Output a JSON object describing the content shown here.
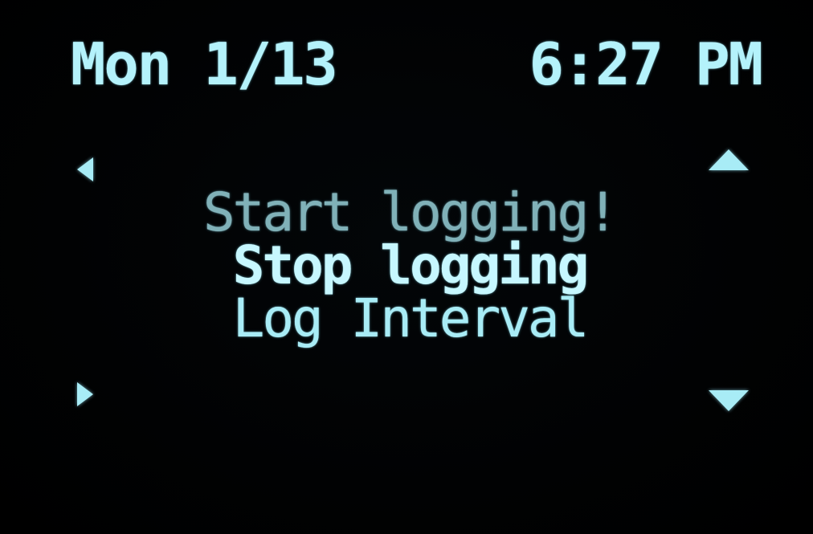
{
  "status_bar": {
    "date": "Mon 1/13",
    "time": "6:27 PM"
  },
  "menu": {
    "items": [
      {
        "label": "Start logging!"
      },
      {
        "label": "Stop logging"
      },
      {
        "label": "Log Interval"
      }
    ],
    "selected_item": "Stop logging"
  },
  "icons": {
    "left": "arrow-left-icon",
    "right": "arrow-right-icon",
    "up": "arrow-up-icon",
    "down": "arrow-down-icon"
  },
  "colors": {
    "background": "#000000",
    "foreground": "#a8ecf6"
  }
}
